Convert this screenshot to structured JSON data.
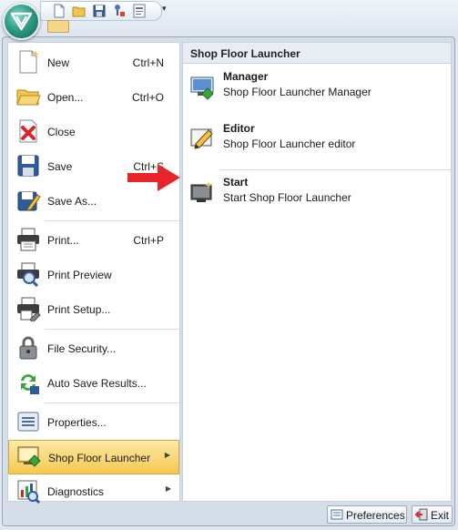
{
  "menu": {
    "items": [
      {
        "label": "New",
        "shortcut": "Ctrl+N",
        "icon": "new-document-icon"
      },
      {
        "label": "Open...",
        "shortcut": "Ctrl+O",
        "icon": "open-folder-icon"
      },
      {
        "label": "Close",
        "shortcut": "",
        "icon": "close-document-icon"
      },
      {
        "label": "Save",
        "shortcut": "Ctrl+S",
        "icon": "save-disk-icon"
      },
      {
        "label": "Save As...",
        "shortcut": "",
        "icon": "save-as-icon"
      },
      {
        "label": "Print...",
        "shortcut": "Ctrl+P",
        "icon": "printer-icon"
      },
      {
        "label": "Print Preview",
        "shortcut": "",
        "icon": "print-preview-icon"
      },
      {
        "label": "Print Setup...",
        "shortcut": "",
        "icon": "print-setup-icon"
      },
      {
        "label": "File Security...",
        "shortcut": "",
        "icon": "padlock-icon"
      },
      {
        "label": "Auto Save Results...",
        "shortcut": "",
        "icon": "auto-save-icon"
      },
      {
        "label": "Properties...",
        "shortcut": "",
        "icon": "properties-icon"
      },
      {
        "label": "Shop Floor Launcher",
        "shortcut": "",
        "icon": "shop-floor-launcher-icon"
      },
      {
        "label": "Diagnostics",
        "shortcut": "",
        "icon": "diagnostics-icon"
      }
    ]
  },
  "submenu": {
    "title": "Shop Floor Launcher",
    "items": [
      {
        "title": "Manager",
        "description": "Shop Floor Launcher Manager",
        "icon": "manager-icon"
      },
      {
        "title": "Editor",
        "description": "Shop Floor Launcher editor",
        "icon": "editor-pencil-icon"
      },
      {
        "title": "Start",
        "description": "Start Shop Floor Launcher",
        "icon": "start-launcher-icon"
      }
    ]
  },
  "footer": {
    "preferences_label": "Preferences",
    "exit_label": "Exit"
  },
  "colors": {
    "accent_highlight": "#f8c84d",
    "arrow": "#e8262a",
    "orb": "#2f9d86"
  }
}
